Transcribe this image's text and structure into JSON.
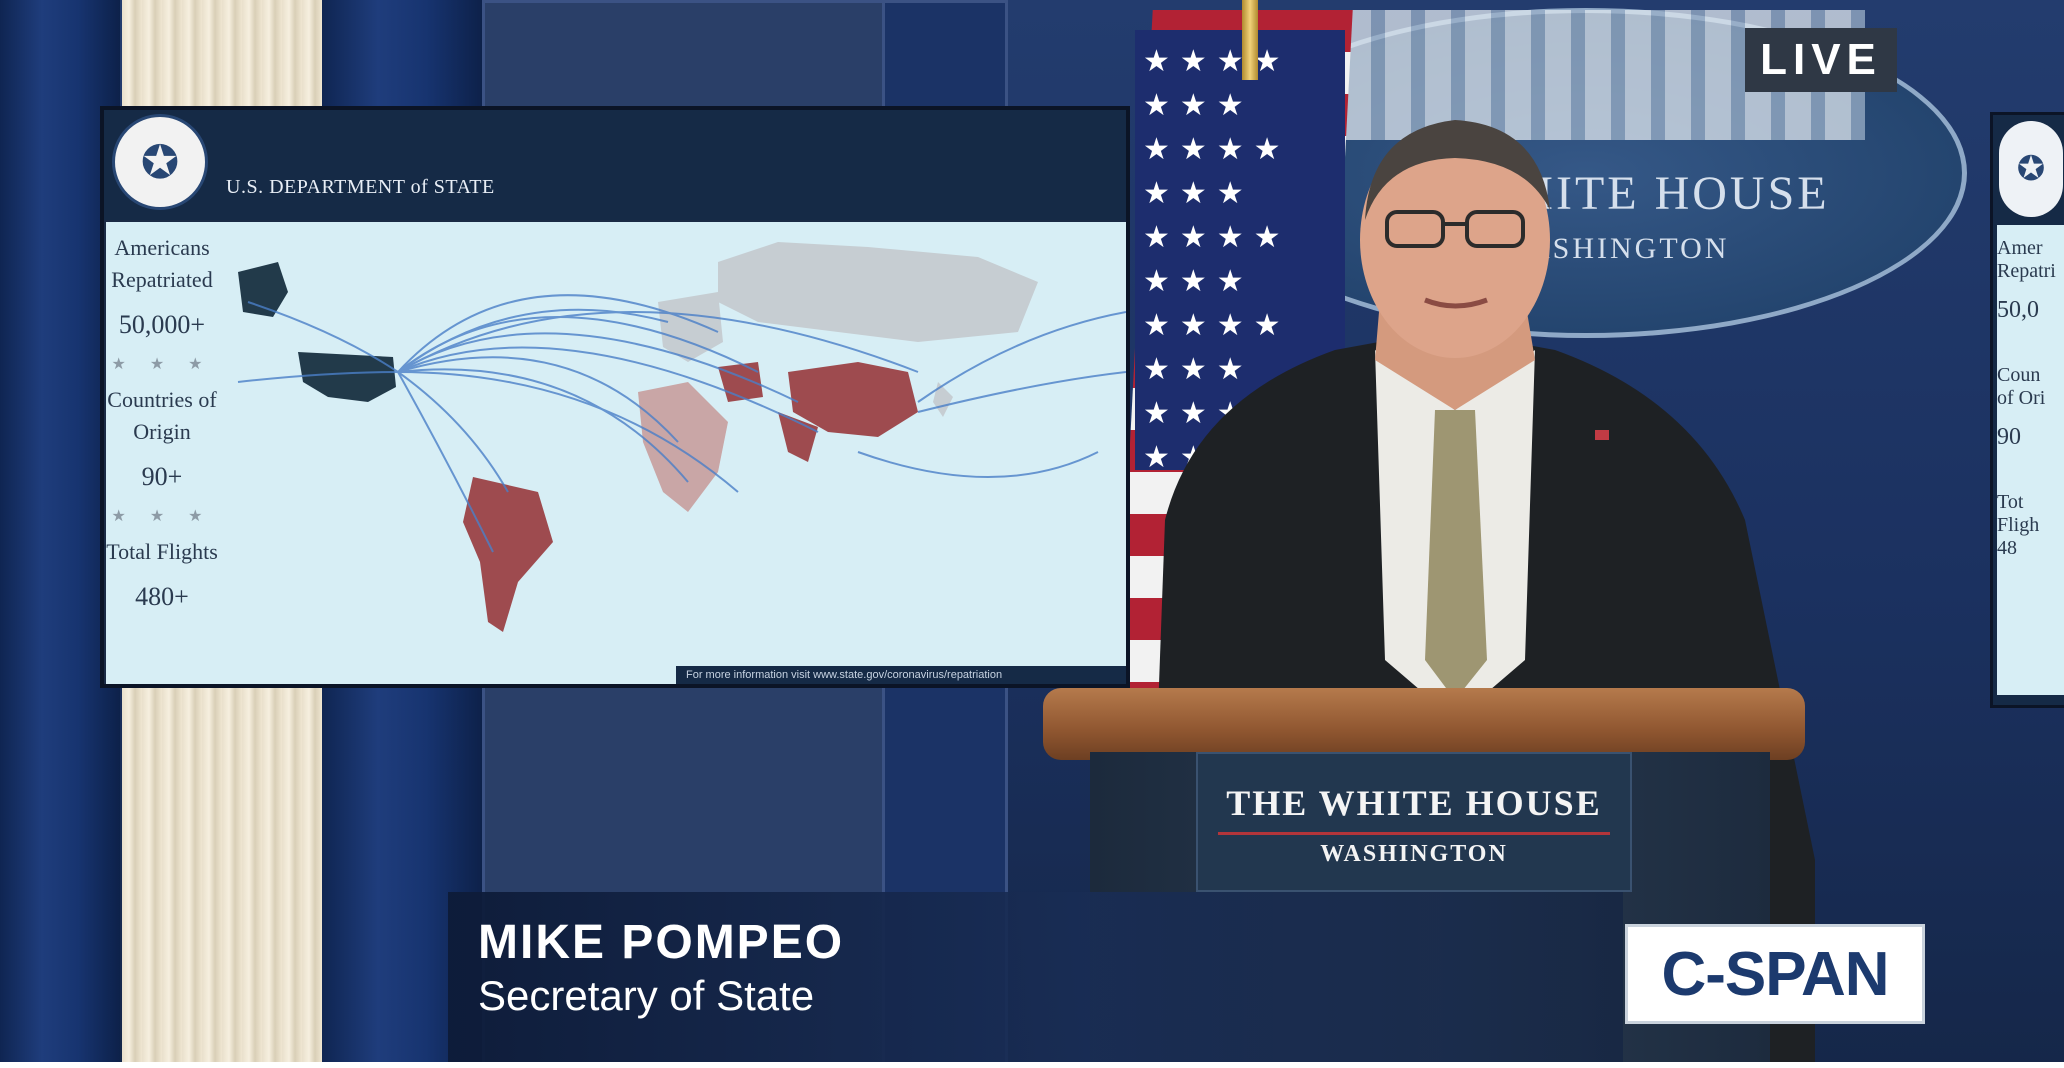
{
  "broadcast": {
    "live_label": "LIVE",
    "network_logo": "C-SPAN"
  },
  "lower_third": {
    "name": "MIKE POMPEO",
    "title": "Secretary of State"
  },
  "backdrop": {
    "seal_line1": "WHITE HOUSE",
    "seal_line2": "WASHINGTON"
  },
  "podium": {
    "title": "THE WHITE HOUSE",
    "subtitle": "WASHINGTON"
  },
  "monitor": {
    "header": "U.S. DEPARTMENT of STATE",
    "stats": [
      {
        "label": "Americans Repatriated",
        "value": "50,000+"
      },
      {
        "label": "Countries of Origin",
        "value": "90+"
      },
      {
        "label": "Total Flights",
        "value": "480+"
      }
    ],
    "stars": "★ ★ ★",
    "footer_note": "For more information visit www.state.gov/coronavirus/repatriation"
  },
  "screen2": {
    "lines": [
      "Amer",
      "Repatri",
      "50,0",
      "Coun",
      "of Ori",
      "90",
      "Tot",
      "Fligh",
      "48"
    ]
  },
  "colors": {
    "cspan_blue": "#1c3a6e",
    "map_ocean": "#d7eef5",
    "map_highlight": "#9e4b4f",
    "flight_arc": "#4a7fc8"
  },
  "icons": {
    "dos_seal": "eagle-seal-icon",
    "flag": "american-flag"
  }
}
